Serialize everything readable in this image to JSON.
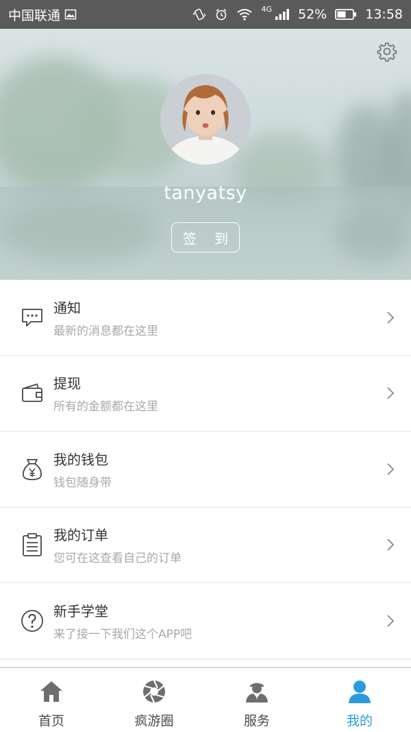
{
  "status_bar": {
    "carrier": "中国联通",
    "network": "4G",
    "battery": "52%",
    "time": "13:58"
  },
  "profile": {
    "username": "tanyatsy",
    "checkin_label": "签 到",
    "settings_icon": "gear-icon"
  },
  "menu": {
    "items": [
      {
        "title": "通知",
        "subtitle": "最新的消息都在这里",
        "icon": "message-icon"
      },
      {
        "title": "提现",
        "subtitle": "所有的金额都在这里",
        "icon": "wallet-icon"
      },
      {
        "title": "我的钱包",
        "subtitle": "钱包随身带",
        "icon": "money-bag-icon"
      },
      {
        "title": "我的订单",
        "subtitle": "您可在这查看自己的订单",
        "icon": "clipboard-icon"
      },
      {
        "title": "新手学堂",
        "subtitle": "来了接一下我们这个APP吧",
        "icon": "question-icon"
      }
    ]
  },
  "tabbar": {
    "tabs": [
      {
        "label": "首页",
        "icon": "home-icon",
        "active": false
      },
      {
        "label": "疯游圈",
        "icon": "aperture-icon",
        "active": false
      },
      {
        "label": "服务",
        "icon": "agent-icon",
        "active": false
      },
      {
        "label": "我的",
        "icon": "user-icon",
        "active": true
      }
    ]
  },
  "colors": {
    "accent": "#2a9be0",
    "status_bar": "#5a5a5a",
    "text_primary": "#333333",
    "text_secondary": "#a8a8a8"
  }
}
